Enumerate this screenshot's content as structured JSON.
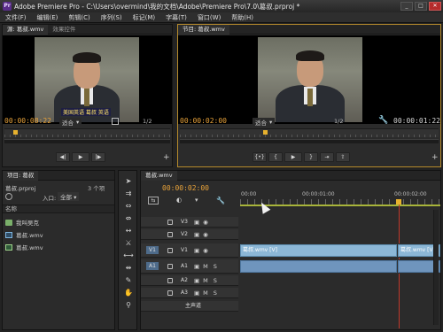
{
  "window": {
    "title": "Adobe Premiere Pro - C:\\Users\\overmind\\我的文档\\Adobe\\Premiere Pro\\7.0\\葛叔.prproj *",
    "app_icon": "Pr",
    "btn_min": "_",
    "btn_max": "□",
    "btn_close": "✕"
  },
  "menu": {
    "items": [
      "文件(F)",
      "编辑(E)",
      "剪辑(C)",
      "序列(S)",
      "标记(M)",
      "字幕(T)",
      "窗口(W)",
      "帮助(H)"
    ]
  },
  "source_monitor": {
    "tab_label": "源: 葛叔.wmv",
    "tab2_label": "效果控件",
    "subtitle": "美国英语 葛叔 英语",
    "timecode": "00:00:08:22",
    "fit_label": "适合",
    "fraction": "1/2",
    "controls": [
      "◀|",
      "▶",
      "|▶"
    ]
  },
  "program_monitor": {
    "tab_label": "节目: 葛叔.wmv",
    "timecode": "00:00:02:00",
    "fit_label": "适合",
    "fraction": "1/2",
    "duration": "00:00:01:22",
    "controls": [
      "{•}",
      "{",
      "▶",
      "}",
      "⇥",
      "⇪"
    ]
  },
  "project_panel": {
    "tab_label": "项目: 葛叔",
    "file": "葛叔.prproj",
    "count": "3 个项",
    "entry_label": "入口:",
    "entry_value": "全部",
    "column_header": "名称",
    "items": [
      {
        "label": "我叫吴克",
        "icon": "bin"
      },
      {
        "label": "葛叔.wmv",
        "icon": "clip"
      },
      {
        "label": "葛叔.wmv",
        "icon": "sequence"
      }
    ]
  },
  "timeline": {
    "tab_label": "葛叔.wmv",
    "timecode": "00:00:02:00",
    "ruler_labels": [
      "00:00",
      "00:00:01:00",
      "00:00:02:00"
    ],
    "tracks": [
      {
        "name": "V3",
        "target": ""
      },
      {
        "name": "V2",
        "target": ""
      },
      {
        "name": "V1",
        "target": "V1"
      },
      {
        "name": "A1",
        "target": "A1"
      },
      {
        "name": "A2",
        "target": ""
      },
      {
        "name": "A3",
        "target": ""
      },
      {
        "name": "主声道",
        "target": ""
      }
    ],
    "mute_label": "M",
    "solo_label": "S",
    "clips": [
      {
        "label": "葛叔.wmv [V]"
      },
      {
        "label": "葛叔.wmv [V]"
      }
    ]
  },
  "colors": {
    "timecode": "#e9a33a",
    "clip_video": "#8cb7d6",
    "playhead": "#e7b12e",
    "in_out_line": "#c0392b"
  },
  "icons": [
    "search-icon",
    "wrench-icon",
    "plus-icon",
    "selection-tool-icon",
    "razor-tool-icon",
    "hand-tool-icon",
    "zoom-tool-icon",
    "pen-tool-icon"
  ]
}
